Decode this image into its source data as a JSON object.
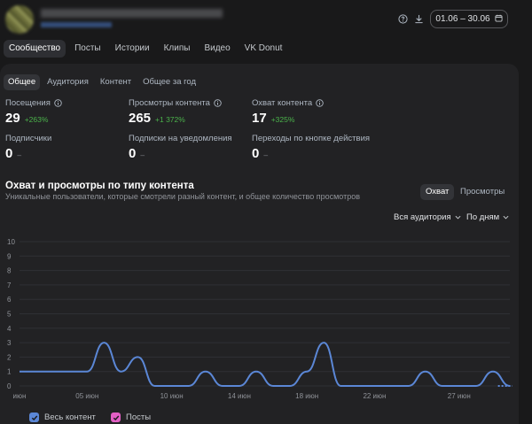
{
  "header": {
    "date_range": "01.06 – 30.06"
  },
  "main_tabs": [
    {
      "label": "Сообщество",
      "active": true
    },
    {
      "label": "Посты",
      "active": false
    },
    {
      "label": "Истории",
      "active": false
    },
    {
      "label": "Клипы",
      "active": false
    },
    {
      "label": "Видео",
      "active": false
    },
    {
      "label": "VK Donut",
      "active": false
    }
  ],
  "sub_tabs": [
    {
      "label": "Общее",
      "active": true
    },
    {
      "label": "Аудитория",
      "active": false
    },
    {
      "label": "Контент",
      "active": false
    },
    {
      "label": "Общее за год",
      "active": false
    }
  ],
  "stats": [
    {
      "label": "Посещения",
      "value": "29",
      "delta": "+263%",
      "info": true
    },
    {
      "label": "Просмотры контента",
      "value": "265",
      "delta": "+1 372%",
      "info": true
    },
    {
      "label": "Охват контента",
      "value": "17",
      "delta": "+325%",
      "info": true
    },
    {
      "label": "Подписчики",
      "value": "0",
      "delta": "–",
      "info": false
    },
    {
      "label": "Подписки на уведомления",
      "value": "0",
      "delta": "–",
      "info": false
    },
    {
      "label": "Переходы по кнопке действия",
      "value": "0",
      "delta": "–",
      "info": false
    }
  ],
  "chart_section": {
    "title": "Охват и просмотры по типу контента",
    "subtitle": "Уникальные пользователи, которые смотрели разный контент, и общее количество просмотров",
    "toggle_reach": "Охват",
    "toggle_views": "Просмотры",
    "audience_dropdown": "Вся аудитория",
    "period_dropdown": "По дням"
  },
  "colors": {
    "accent_blue": "#5b87d6",
    "positive_green": "#4bb34b",
    "posts_pink": "#e25fc4"
  },
  "chart_data": {
    "type": "line",
    "ylim": [
      0,
      10
    ],
    "yticks": [
      0,
      1,
      2,
      3,
      4,
      5,
      6,
      7,
      8,
      9,
      10
    ],
    "x": [
      1,
      2,
      3,
      4,
      5,
      6,
      7,
      8,
      9,
      10,
      11,
      12,
      13,
      14,
      15,
      16,
      17,
      18,
      19,
      20,
      21,
      22,
      23,
      24,
      25,
      26,
      27,
      28,
      29,
      30
    ],
    "xtick_labels": [
      "июн",
      "05 июн",
      "10 июн",
      "14 июн",
      "18 июн",
      "22 июн",
      "27 июн"
    ],
    "series": [
      {
        "name": "Весь контент",
        "values": [
          1,
          1,
          1,
          1,
          1,
          3,
          1,
          2,
          0,
          0,
          0,
          1,
          0,
          0,
          1,
          0,
          0,
          1,
          3,
          0,
          0,
          0,
          0,
          0,
          1,
          0,
          0,
          0,
          1,
          0
        ]
      },
      {
        "name": "Посты",
        "values": []
      }
    ]
  }
}
